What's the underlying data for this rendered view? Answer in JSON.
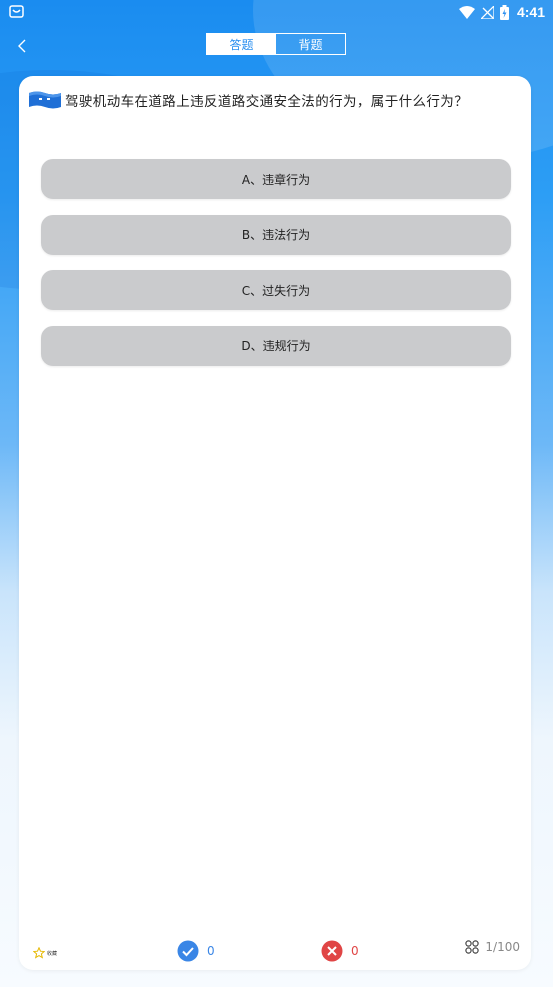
{
  "status_bar": {
    "time": "4:41"
  },
  "header": {
    "tabs": [
      {
        "label": "答题",
        "active": true
      },
      {
        "label": "背题",
        "active": false
      }
    ]
  },
  "question": {
    "text": "驾驶机动车在道路上违反道路交通安全法的行为，属于什么行为？",
    "flag_icon": "flag-icon"
  },
  "options": [
    {
      "label": "A、违章行为"
    },
    {
      "label": "B、违法行为"
    },
    {
      "label": "C、过失行为"
    },
    {
      "label": "D、违规行为"
    }
  ],
  "bottom_bar": {
    "favorite_label": "收藏",
    "correct_count": "0",
    "wrong_count": "0",
    "progress": "1/100"
  },
  "colors": {
    "primary": "#2a8ff0",
    "option_bg": "#cacbcd",
    "correct": "#3a86e6",
    "wrong": "#e04545"
  }
}
